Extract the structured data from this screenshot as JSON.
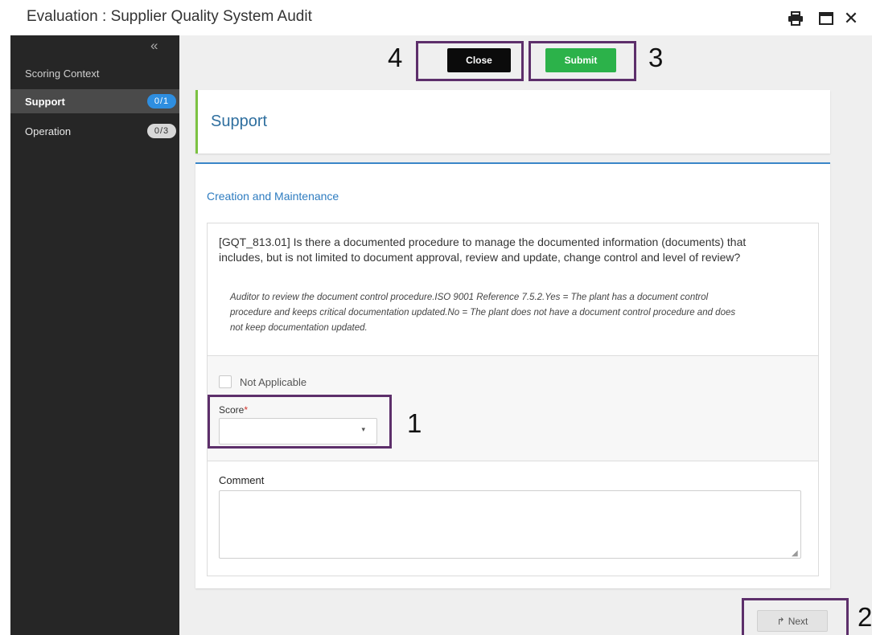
{
  "window": {
    "title": "Evaluation : Supplier Quality System Audit",
    "icons": [
      "printer-icon",
      "maximize-icon",
      "close-icon"
    ],
    "close_glyph": "✕"
  },
  "sidebar": {
    "collapse_glyph": "«",
    "context_label": "Scoring Context",
    "items": [
      {
        "label": "Support",
        "badge": "0/1",
        "active": true
      },
      {
        "label": "Operation",
        "badge": "0/3",
        "active": false
      }
    ]
  },
  "actions": {
    "close_label": "Close",
    "submit_label": "Submit",
    "next_label": "Next",
    "next_glyph": "↱"
  },
  "annotations": {
    "n1": "1",
    "n2": "2",
    "n3": "3",
    "n4": "4"
  },
  "section": {
    "title": "Support"
  },
  "group": {
    "title": "Creation and Maintenance"
  },
  "question": {
    "text": "[GQT_813.01] Is there a documented procedure to manage the documented information (documents) that includes, but is not limited to document approval, review and update, change control and level of review?",
    "help": "Auditor to review the document control procedure.ISO 9001 Reference 7.5.2.Yes = The plant has a document control procedure and keeps critical documentation updated.No = The plant does not have a document control procedure and does not keep documentation updated.",
    "not_applicable_label": "Not Applicable",
    "score_label": "Score",
    "required_mark": "*",
    "score_value": "",
    "caret_glyph": "▾",
    "comment_label": "Comment",
    "comment_value": ""
  },
  "colors": {
    "submit": "#2cb24a",
    "badge_active": "#2e8ee0",
    "section_accent": "#7cc242",
    "annotation_frame": "#5d2f6b"
  }
}
